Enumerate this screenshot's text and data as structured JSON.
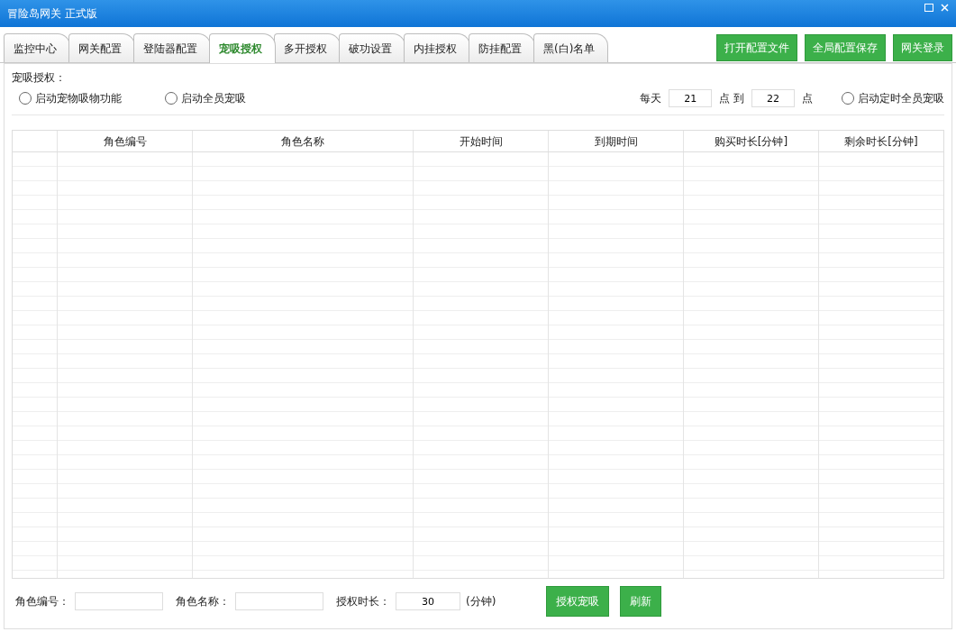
{
  "window": {
    "title": "冒险岛网关 正式版"
  },
  "tabs": [
    {
      "label": "监控中心",
      "selected": false
    },
    {
      "label": "网关配置",
      "selected": false
    },
    {
      "label": "登陆器配置",
      "selected": false
    },
    {
      "label": "宠吸授权",
      "selected": true
    },
    {
      "label": "多开授权",
      "selected": false
    },
    {
      "label": "破功设置",
      "selected": false
    },
    {
      "label": "内挂授权",
      "selected": false
    },
    {
      "label": "防挂配置",
      "selected": false
    },
    {
      "label": "黑(白)名单",
      "selected": false
    }
  ],
  "toolbar_buttons": [
    "打开配置文件",
    "全局配置保存",
    "网关登录"
  ],
  "group": {
    "title": "宠吸授权：",
    "options": [
      {
        "label": "启动宠物吸物功能",
        "checked": false
      },
      {
        "label": "启动全员宠吸",
        "checked": false
      }
    ],
    "schedule": {
      "prefix": "每天",
      "start": "21",
      "middle": "点 到",
      "end": "22",
      "suffix": "点",
      "option": {
        "label": "启动定时全员宠吸",
        "checked": false
      }
    }
  },
  "table": {
    "columns": [
      "角色编号",
      "角色名称",
      "开始时间",
      "到期时间",
      "购买时长[分钟]",
      "剩余时长[分钟]"
    ]
  },
  "form": {
    "fields": [
      {
        "label": "角色编号："
      },
      {
        "label": "角色名称："
      },
      {
        "label": "授权时长：",
        "value": "30",
        "unit": "(分钟)"
      }
    ],
    "buttons": [
      "授权宠吸",
      "刷新"
    ]
  }
}
